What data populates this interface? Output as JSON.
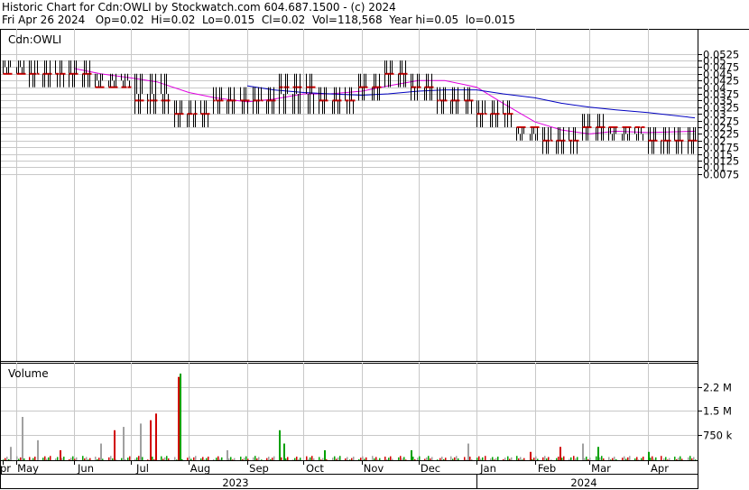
{
  "header": {
    "line1": "Historic Chart for Cdn:OWLI by Stockwatch.com 604.687.1500 - (c) 2024",
    "line2": "Fri Apr 26 2024   Op=0.02  Hi=0.02  Lo=0.015  Cl=0.02  Vol=118,568  Year hi=0.05  lo=0.015"
  },
  "chart_data": {
    "type": "ohlc",
    "symbol_label": "Cdn:OWLI",
    "volume_label": "Volume",
    "price_axis_ticks": [
      "0.0525",
      "0.05",
      "0.0475",
      "0.045",
      "0.0425",
      "0.04",
      "0.0375",
      "0.035",
      "0.0325",
      "0.03",
      "0.0275",
      "0.025",
      "0.0225",
      "0.02",
      "0.0175",
      "0.015",
      "0.0125",
      "0.01",
      "0.0075"
    ],
    "volume_axis_ticks": [
      "2.2 M",
      "1.5 M",
      "750 k"
    ],
    "month_labels": [
      "pr",
      "May",
      "Jun",
      "Jul",
      "Aug",
      "Sep",
      "Oct",
      "Nov",
      "Dec",
      "Jan",
      "Feb",
      "Mar",
      "Apr"
    ],
    "year_labels": [
      "2023",
      "2024"
    ],
    "ylim": [
      0.005,
      0.054
    ],
    "volume_max_millions": 2.6,
    "colors": {
      "bars": "#000000",
      "close_tick": "#d00000",
      "ma_short": "#e000e0",
      "ma_long": "#0000c0",
      "vol_up": "#00a000",
      "vol_down": "#d00000",
      "vol_flat": "#a0a0a0",
      "grid": "#c8c8c8"
    },
    "price_segments": [
      {
        "from": "2023-04-24",
        "to": "2023-05-05",
        "low": 0.045,
        "high": 0.05,
        "close": 0.045
      },
      {
        "from": "2023-05-08",
        "to": "2023-05-26",
        "low": 0.04,
        "high": 0.05,
        "close": 0.045
      },
      {
        "from": "2023-05-29",
        "to": "2023-06-09",
        "low": 0.04,
        "high": 0.05,
        "close": 0.045
      },
      {
        "from": "2023-06-12",
        "to": "2023-06-30",
        "low": 0.04,
        "high": 0.045,
        "close": 0.04
      },
      {
        "from": "2023-07-03",
        "to": "2023-07-21",
        "low": 0.03,
        "high": 0.045,
        "close": 0.035
      },
      {
        "from": "2023-07-24",
        "to": "2023-08-11",
        "low": 0.025,
        "high": 0.035,
        "close": 0.03
      },
      {
        "from": "2023-08-14",
        "to": "2023-09-01",
        "low": 0.03,
        "high": 0.04,
        "close": 0.035
      },
      {
        "from": "2023-09-04",
        "to": "2023-09-15",
        "low": 0.03,
        "high": 0.04,
        "close": 0.035
      },
      {
        "from": "2023-09-18",
        "to": "2023-10-06",
        "low": 0.03,
        "high": 0.045,
        "close": 0.04
      },
      {
        "from": "2023-10-09",
        "to": "2023-10-27",
        "low": 0.03,
        "high": 0.04,
        "close": 0.035
      },
      {
        "from": "2023-10-30",
        "to": "2023-11-10",
        "low": 0.035,
        "high": 0.045,
        "close": 0.04
      },
      {
        "from": "2023-11-13",
        "to": "2023-11-24",
        "low": 0.04,
        "high": 0.05,
        "close": 0.045
      },
      {
        "from": "2023-11-27",
        "to": "2023-12-08",
        "low": 0.035,
        "high": 0.045,
        "close": 0.04
      },
      {
        "from": "2023-12-11",
        "to": "2023-12-29",
        "low": 0.03,
        "high": 0.04,
        "close": 0.035
      },
      {
        "from": "2024-01-01",
        "to": "2024-01-19",
        "low": 0.025,
        "high": 0.035,
        "close": 0.03
      },
      {
        "from": "2024-01-22",
        "to": "2024-02-02",
        "low": 0.02,
        "high": 0.025,
        "close": 0.025
      },
      {
        "from": "2024-02-05",
        "to": "2024-02-23",
        "low": 0.015,
        "high": 0.025,
        "close": 0.02
      },
      {
        "from": "2024-02-26",
        "to": "2024-03-08",
        "low": 0.02,
        "high": 0.03,
        "close": 0.025
      },
      {
        "from": "2024-03-11",
        "to": "2024-03-29",
        "low": 0.02,
        "high": 0.025,
        "close": 0.025
      },
      {
        "from": "2024-04-01",
        "to": "2024-04-26",
        "low": 0.015,
        "high": 0.025,
        "close": 0.02
      }
    ],
    "moving_average_short": [
      {
        "date": "2023-06-01",
        "value": 0.047
      },
      {
        "date": "2023-06-15",
        "value": 0.045
      },
      {
        "date": "2023-07-01",
        "value": 0.0435
      },
      {
        "date": "2023-07-15",
        "value": 0.042
      },
      {
        "date": "2023-08-01",
        "value": 0.038
      },
      {
        "date": "2023-08-15",
        "value": 0.036
      },
      {
        "date": "2023-09-01",
        "value": 0.0345
      },
      {
        "date": "2023-09-15",
        "value": 0.0355
      },
      {
        "date": "2023-10-01",
        "value": 0.0375
      },
      {
        "date": "2023-10-15",
        "value": 0.0375
      },
      {
        "date": "2023-11-01",
        "value": 0.0385
      },
      {
        "date": "2023-11-15",
        "value": 0.0405
      },
      {
        "date": "2023-12-01",
        "value": 0.0425
      },
      {
        "date": "2023-12-15",
        "value": 0.0425
      },
      {
        "date": "2024-01-01",
        "value": 0.04
      },
      {
        "date": "2024-01-15",
        "value": 0.034
      },
      {
        "date": "2024-02-01",
        "value": 0.027
      },
      {
        "date": "2024-02-15",
        "value": 0.024
      },
      {
        "date": "2024-03-01",
        "value": 0.0225
      },
      {
        "date": "2024-03-15",
        "value": 0.0235
      },
      {
        "date": "2024-04-01",
        "value": 0.023
      },
      {
        "date": "2024-04-26",
        "value": 0.0235
      }
    ],
    "moving_average_long": [
      {
        "date": "2023-09-01",
        "value": 0.0405
      },
      {
        "date": "2023-09-15",
        "value": 0.039
      },
      {
        "date": "2023-10-01",
        "value": 0.038
      },
      {
        "date": "2023-10-15",
        "value": 0.0375
      },
      {
        "date": "2023-11-01",
        "value": 0.037
      },
      {
        "date": "2023-11-15",
        "value": 0.0375
      },
      {
        "date": "2023-12-01",
        "value": 0.0385
      },
      {
        "date": "2023-12-15",
        "value": 0.039
      },
      {
        "date": "2024-01-01",
        "value": 0.039
      },
      {
        "date": "2024-01-15",
        "value": 0.0375
      },
      {
        "date": "2024-02-01",
        "value": 0.036
      },
      {
        "date": "2024-02-15",
        "value": 0.034
      },
      {
        "date": "2024-03-01",
        "value": 0.0325
      },
      {
        "date": "2024-03-15",
        "value": 0.0315
      },
      {
        "date": "2024-04-01",
        "value": 0.0305
      },
      {
        "date": "2024-04-26",
        "value": 0.0285
      }
    ],
    "volume_spikes": [
      {
        "date": "2023-04-28",
        "volume_millions": 0.4,
        "dir": "flat"
      },
      {
        "date": "2023-05-04",
        "volume_millions": 1.3,
        "dir": "flat"
      },
      {
        "date": "2023-05-12",
        "volume_millions": 0.6,
        "dir": "flat"
      },
      {
        "date": "2023-05-24",
        "volume_millions": 0.3,
        "dir": "down"
      },
      {
        "date": "2023-06-15",
        "volume_millions": 0.5,
        "dir": "flat"
      },
      {
        "date": "2023-06-22",
        "volume_millions": 0.9,
        "dir": "down"
      },
      {
        "date": "2023-06-27",
        "volume_millions": 1.0,
        "dir": "flat"
      },
      {
        "date": "2023-07-06",
        "volume_millions": 1.1,
        "dir": "flat"
      },
      {
        "date": "2023-07-11",
        "volume_millions": 1.2,
        "dir": "down"
      },
      {
        "date": "2023-07-14",
        "volume_millions": 1.4,
        "dir": "down"
      },
      {
        "date": "2023-07-26",
        "volume_millions": 2.5,
        "dir": "down"
      },
      {
        "date": "2023-07-27",
        "volume_millions": 2.6,
        "dir": "up"
      },
      {
        "date": "2023-08-21",
        "volume_millions": 0.3,
        "dir": "flat"
      },
      {
        "date": "2023-09-18",
        "volume_millions": 0.9,
        "dir": "up"
      },
      {
        "date": "2023-09-20",
        "volume_millions": 0.5,
        "dir": "up"
      },
      {
        "date": "2023-10-12",
        "volume_millions": 0.3,
        "dir": "up"
      },
      {
        "date": "2023-11-27",
        "volume_millions": 0.3,
        "dir": "up"
      },
      {
        "date": "2023-12-27",
        "volume_millions": 0.5,
        "dir": "flat"
      },
      {
        "date": "2024-01-29",
        "volume_millions": 0.25,
        "dir": "down"
      },
      {
        "date": "2024-02-14",
        "volume_millions": 0.4,
        "dir": "down"
      },
      {
        "date": "2024-02-26",
        "volume_millions": 0.5,
        "dir": "flat"
      },
      {
        "date": "2024-03-05",
        "volume_millions": 0.4,
        "dir": "up"
      },
      {
        "date": "2024-04-01",
        "volume_millions": 0.25,
        "dir": "up"
      }
    ],
    "grid": true
  }
}
